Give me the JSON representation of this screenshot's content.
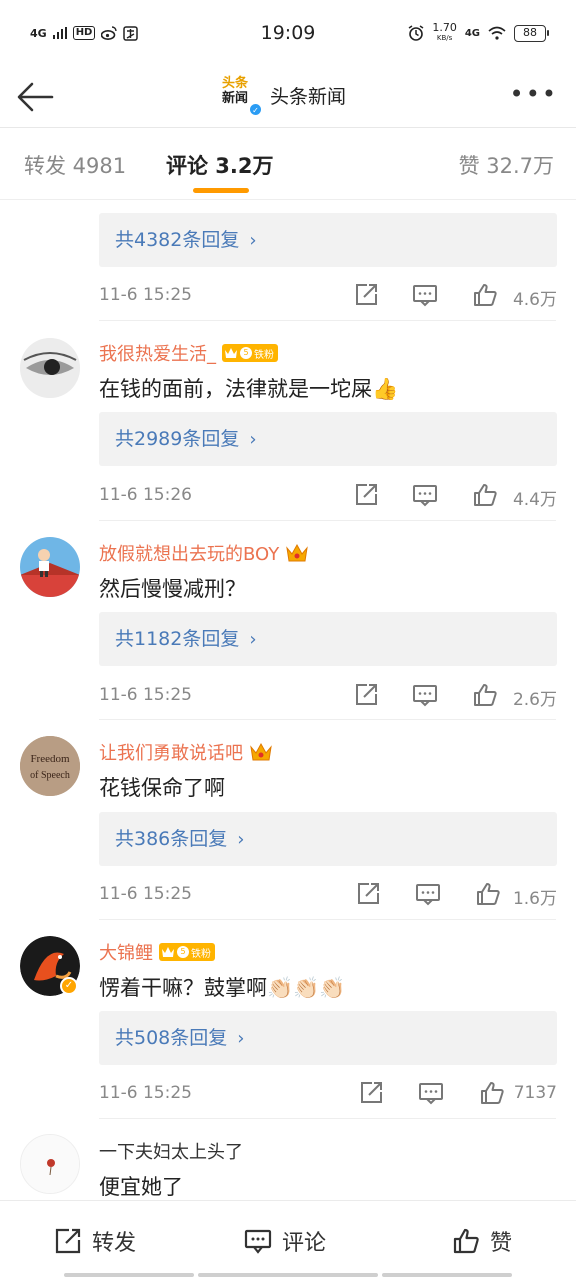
{
  "status": {
    "left_tags": [
      "4G",
      "HD"
    ],
    "time": "19:09",
    "speed_value": "1.70",
    "speed_unit": "KB/s",
    "network": "4G",
    "battery": "88"
  },
  "header": {
    "logo_line1": "头条",
    "logo_line2": "新闻",
    "title": "头条新闻"
  },
  "tabs": {
    "repost": "转发 4981",
    "comments": "评论 3.2万",
    "likes": "赞 32.7万"
  },
  "comments": [
    {
      "username": "",
      "text": "",
      "replies": "共4382条回复",
      "time": "11-6 15:25",
      "likes": "4.6万"
    },
    {
      "username": "我很热爱生活_",
      "badge": "铁粉",
      "badge_level": "5",
      "text": "在钱的面前，法律就是一坨屎👍",
      "replies": "共2989条回复",
      "time": "11-6 15:26",
      "likes": "4.4万"
    },
    {
      "username": "放假就想出去玩的BOY",
      "text": "然后慢慢减刑？",
      "replies": "共1182条回复",
      "time": "11-6 15:25",
      "likes": "2.6万"
    },
    {
      "username": "让我们勇敢说话吧",
      "avatar_text_1": "Freedom",
      "avatar_text_2": "of Speech",
      "text": "花钱保命了啊",
      "replies": "共386条回复",
      "time": "11-6 15:25",
      "likes": "1.6万"
    },
    {
      "username": "大锦鲤",
      "badge": "铁粉",
      "badge_level": "5",
      "text": "愣着干嘛？鼓掌啊👏🏻👏🏻👏🏻",
      "replies": "共508条回复",
      "time": "11-6 15:25",
      "likes": "7137"
    },
    {
      "username": "一下夫妇太上头了",
      "text": "便宜她了"
    }
  ],
  "bottom_bar": {
    "repost": "转发",
    "comment": "评论",
    "like": "赞"
  },
  "colors": {
    "accent": "#ff9a00",
    "username": "#eb7350",
    "link": "#4a7ab8"
  }
}
